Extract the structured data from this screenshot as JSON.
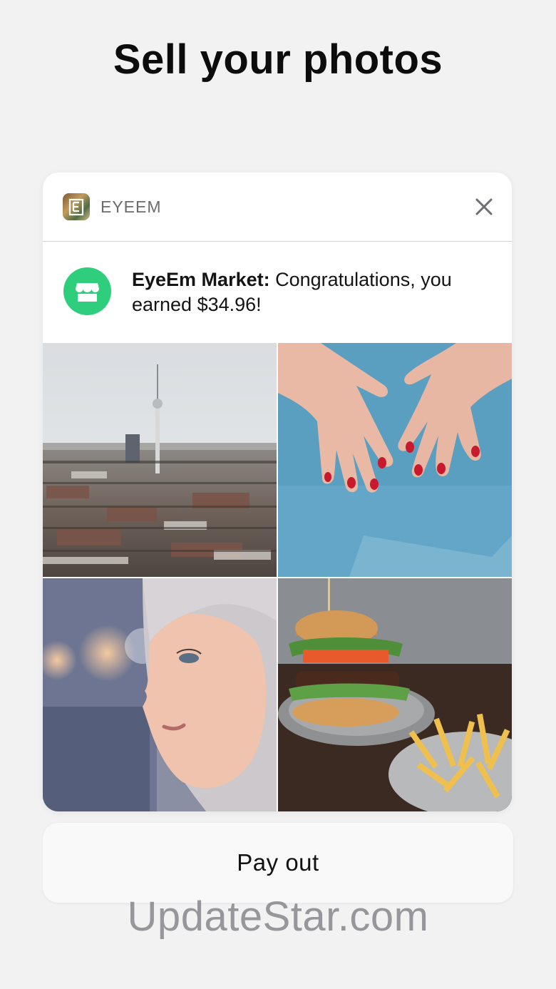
{
  "headline": "Sell your photos",
  "notification": {
    "app_name": "EYEEM",
    "app_icon": "eyeem-app-icon",
    "close_icon": "close-icon",
    "market_icon": "storefront-icon",
    "sender": "EyeEm Market:",
    "message": " Congratulations, you earned $34.96!",
    "accent_color": "#2fce7c"
  },
  "photos": [
    {
      "subject": "city-skyline-tv-tower"
    },
    {
      "subject": "hands-red-nails"
    },
    {
      "subject": "woman-portrait"
    },
    {
      "subject": "burger-and-fries"
    }
  ],
  "payout_button": "Pay out",
  "watermark": "UpdateStar.com"
}
